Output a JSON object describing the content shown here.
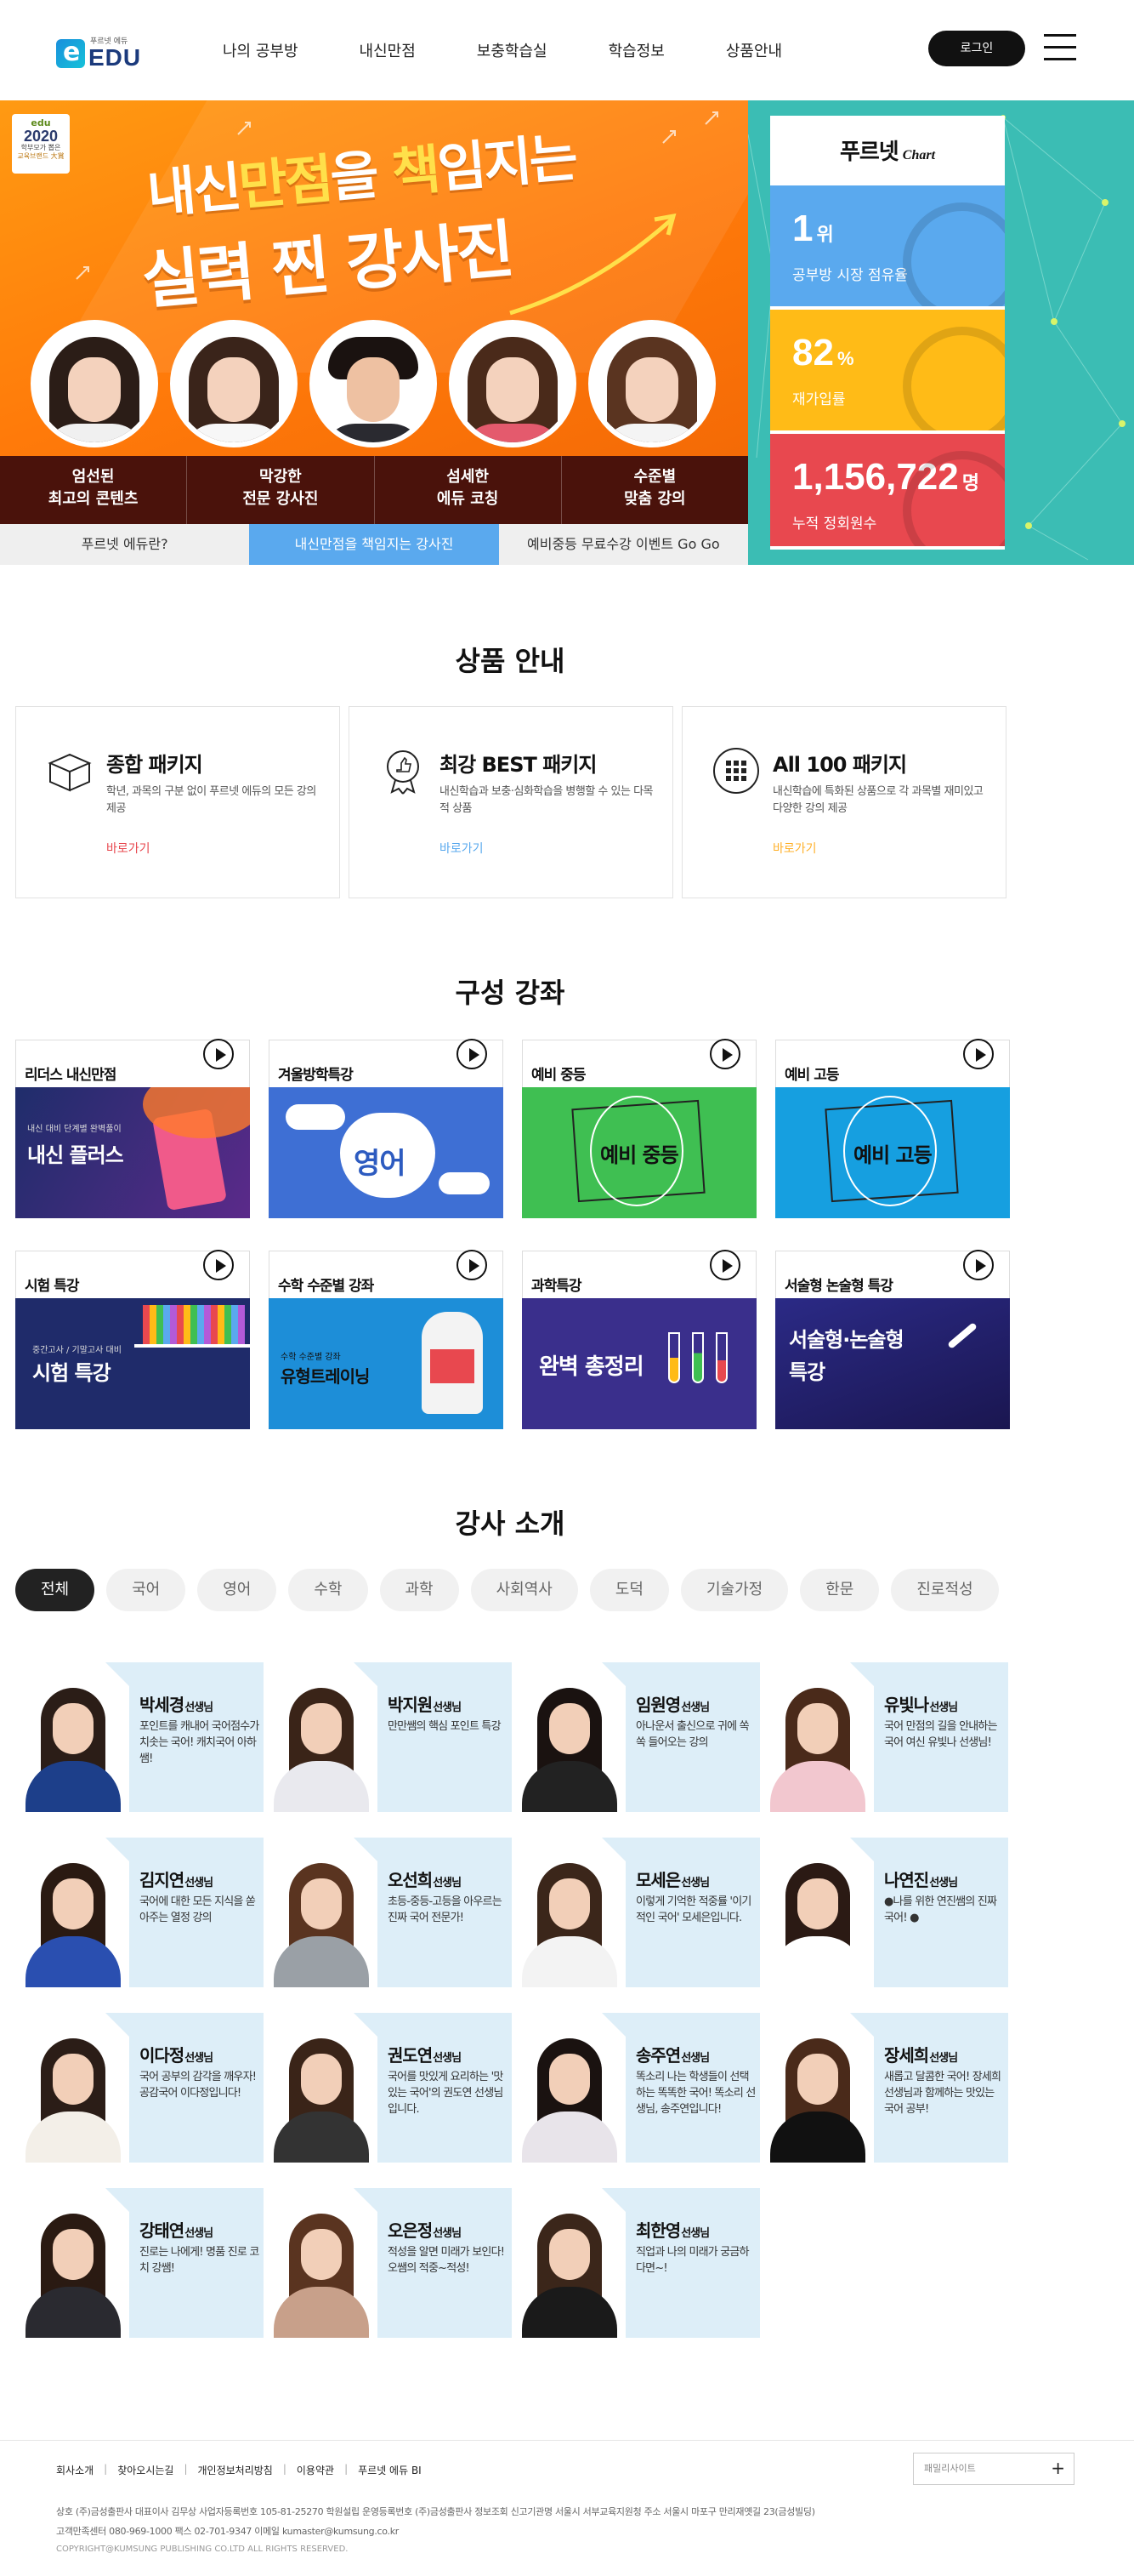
{
  "header": {
    "logo_tag": "푸르넷 에듀",
    "logo_text": "EDU",
    "nav": [
      "나의 공부방",
      "내신만점",
      "보충학습실",
      "학습정보",
      "상품안내"
    ],
    "login": "로그인"
  },
  "hero": {
    "award": {
      "line1": "edu",
      "line2": "2020",
      "line3": "학부모가 뽑은",
      "line4": "교육브랜드 大賞"
    },
    "title_line1_a": "내신",
    "title_line1_b": "만점",
    "title_line1_c": "을 ",
    "title_line1_d": "책",
    "title_line1_e": "임지는",
    "title_line2": "실력 찐 강사진",
    "captions": [
      {
        "l1": "엄선된",
        "l2": "최고의 콘텐츠"
      },
      {
        "l1": "막강한",
        "l2": "전문 강사진"
      },
      {
        "l1": "섬세한",
        "l2": "에듀 코칭"
      },
      {
        "l1": "수준별",
        "l2": "맞춤 강의"
      }
    ],
    "tabs": [
      "푸르넷 에듀란?",
      "내신만점을 책임지는 강사진",
      "예비중등 무료수강 이벤트 Go Go"
    ],
    "chart": {
      "brand": "푸르넷",
      "sub": "Chart",
      "stats": [
        {
          "num": "1",
          "unit": "위",
          "label": "공부방 시장 점유율"
        },
        {
          "num": "82",
          "unit": "%",
          "label": "재가입률"
        },
        {
          "num": "1,156,722",
          "unit": "명",
          "label": "누적 정회원수"
        }
      ]
    }
  },
  "products": {
    "title": "상품 안내",
    "items": [
      {
        "name": "종합 패키지",
        "desc": "학년, 과목의 구분 없이 푸르넷 에듀의 모든 강의 제공",
        "link": "바로가기",
        "color": "#e8484f"
      },
      {
        "name": "최강 BEST 패키지",
        "desc": "내신학습과 보충·심화학습을 병행할 수 있는 다목적 상품",
        "link": "바로가기",
        "color": "#5aa9ee"
      },
      {
        "name": "All 100 패키지",
        "desc": "내신학습에 특화된 상품으로 각 과목별 재미있고 다양한 강의 제공",
        "link": "바로가기",
        "color": "#ffb12b"
      }
    ]
  },
  "courses": {
    "title": "구성 강좌",
    "items": [
      {
        "name": "리더스 내신만점",
        "caption": "내신 플러스",
        "sub": "내신 대비 단계별 완벽풀이"
      },
      {
        "name": "겨울방학특강",
        "caption": "영어",
        "sub": ""
      },
      {
        "name": "예비 중등",
        "caption": "예비 중등",
        "sub": ""
      },
      {
        "name": "예비 고등",
        "caption": "예비 고등",
        "sub": ""
      },
      {
        "name": "시험 특강",
        "caption": "시험 특강",
        "sub": "중간고사 / 기말고사 대비"
      },
      {
        "name": "수학 수준별 강좌",
        "caption": "유형트레이닝",
        "sub": "수학 수준별 강좌"
      },
      {
        "name": "과학특강",
        "caption": "완벽 총정리",
        "sub": ""
      },
      {
        "name": "서술형 논술형 특강",
        "caption": "서술형·논술형 특강",
        "sub": ""
      }
    ]
  },
  "teachers": {
    "title": "강사 소개",
    "filters": [
      "전체",
      "국어",
      "영어",
      "수학",
      "과학",
      "사회역사",
      "도덕",
      "기술가정",
      "한문",
      "진로적성"
    ],
    "suffix": "선생님",
    "items": [
      {
        "name": "박세경",
        "desc": "포인트를 캐내어 국어점수가 치솟는 국어! 캐치국어 아하쌤!"
      },
      {
        "name": "박지원",
        "desc": "만만쌤의 핵심 포인트 특강"
      },
      {
        "name": "임원영",
        "desc": "아나운서 출신으로 귀에 쏙쏙 들어오는 강의"
      },
      {
        "name": "유빛나",
        "desc": "국어 만점의 길을 안내하는 국어 여신 유빛나 선생님!"
      },
      {
        "name": "김지연",
        "desc": "국어에 대한 모든 지식을 쏟아주는 열정 강의"
      },
      {
        "name": "오선희",
        "desc": "초등-중등-고등을 아우르는 진짜 국어 전문가!"
      },
      {
        "name": "모세은",
        "desc": "이렇게 기억한 적중률 '이기적인 국어' 모세은입니다."
      },
      {
        "name": "나연진",
        "desc": "●나를 위한 연진쌤의 진짜 국어! ●"
      },
      {
        "name": "이다정",
        "desc": "국어 공부의 감각을 깨우자! 공감국어 이다정입니다!"
      },
      {
        "name": "권도연",
        "desc": "국어를 맛있게 요리하는 '맛있는 국어'의 권도연 선생님입니다."
      },
      {
        "name": "송주연",
        "desc": "똑소리 나는 학생들이 선택하는 똑똑한 국어! 똑소리 선생님, 송주연입니다!"
      },
      {
        "name": "장세희",
        "desc": "새롭고 달콤한 국어! 장세희 선생님과 함께하는 맛있는 국어 공부!"
      },
      {
        "name": "강태연",
        "desc": "진로는 나에게! 명품 진로 코치 강쌤!"
      },
      {
        "name": "오은정",
        "desc": "적성을 알면 미래가 보인다! 오쌤의 적중~적성!"
      },
      {
        "name": "최한영",
        "desc": "직업과 나의 미래가 궁금하다면~!"
      }
    ]
  },
  "footer": {
    "links": [
      "회사소개",
      "찾아오시는길",
      "개인정보처리방침",
      "이용약관",
      "푸르넷 에듀 BI"
    ],
    "family": "패밀리사이트",
    "info_line1": "상호 (주)금성출판사   대표이사 김무상   사업자등록번호 105-81-25270   학원설립 운영등록번호 (주)금성출판사 정보조회   신고기관명 서울시 서부교육지원청   주소 서울시 마포구 만리재옛길 23(금성빌딩)",
    "info_line2": "고객만족센터 080-969-1000   팩스 02-701-9347   이메일 kumaster@kumsung.co.kr",
    "copyright": "COPYRIGHT@KUMSUNG PUBLISHING CO.LTD ALL RIGHTS RESERVED."
  },
  "colors": {
    "accent_orange": "#ff8a0c",
    "accent_blue": "#5aa9ee",
    "accent_yellow": "#ffbb17",
    "accent_red": "#e8484f",
    "teal": "#3bbdb4"
  }
}
